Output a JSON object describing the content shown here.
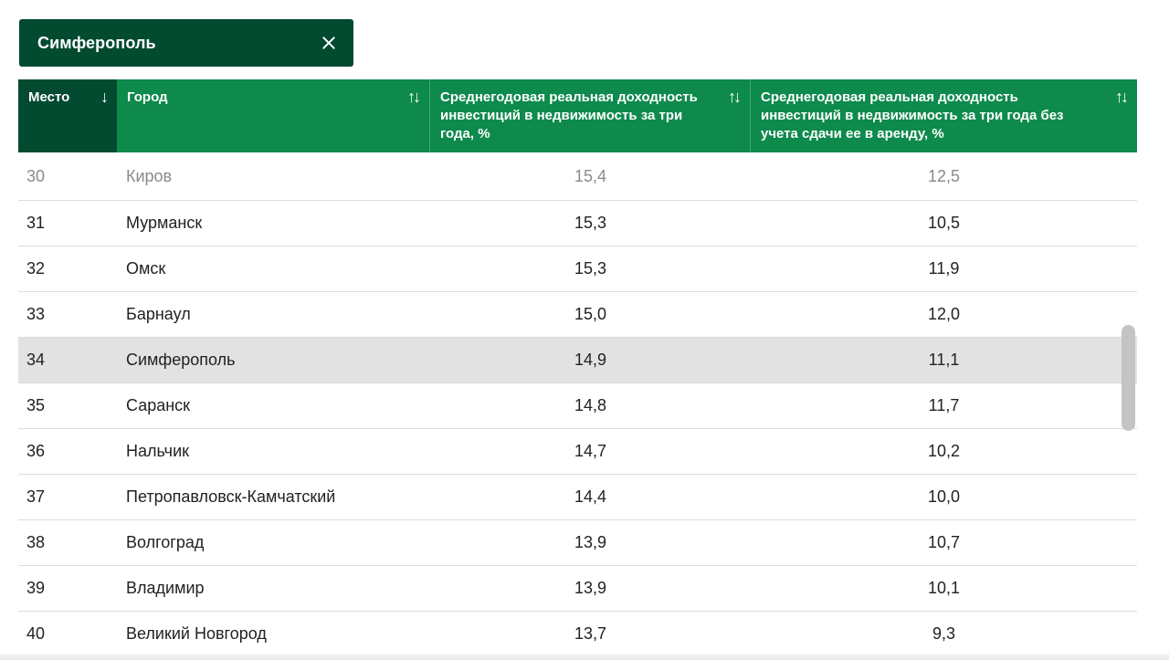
{
  "search_chip": {
    "label": "Симферополь",
    "close_icon": "close-icon"
  },
  "table": {
    "headers": [
      {
        "label": "Место",
        "sort_icon": "↓"
      },
      {
        "label": "Город",
        "sort_icon": "↑↓"
      },
      {
        "label": "Среднегодовая реальная доходность инвестиций в недвижимость за три года, %",
        "sort_icon": "↑↓"
      },
      {
        "label": "Среднегодовая реальная доходность инвестиций в недвижимость за три года без учета сдачи ее в аренду, %",
        "sort_icon": "↑↓"
      }
    ],
    "rows": [
      {
        "place": "30",
        "city": "Киров",
        "yield_rent": "15,4",
        "yield_no_rent": "12,5"
      },
      {
        "place": "31",
        "city": "Мурманск",
        "yield_rent": "15,3",
        "yield_no_rent": "10,5"
      },
      {
        "place": "32",
        "city": "Омск",
        "yield_rent": "15,3",
        "yield_no_rent": "11,9"
      },
      {
        "place": "33",
        "city": "Барнаул",
        "yield_rent": "15,0",
        "yield_no_rent": "12,0"
      },
      {
        "place": "34",
        "city": "Симферополь",
        "yield_rent": "14,9",
        "yield_no_rent": "11,1"
      },
      {
        "place": "35",
        "city": "Саранск",
        "yield_rent": "14,8",
        "yield_no_rent": "11,7"
      },
      {
        "place": "36",
        "city": "Нальчик",
        "yield_rent": "14,7",
        "yield_no_rent": "10,2"
      },
      {
        "place": "37",
        "city": "Петропавловск-Камчатский",
        "yield_rent": "14,4",
        "yield_no_rent": "10,0"
      },
      {
        "place": "38",
        "city": "Волгоград",
        "yield_rent": "13,9",
        "yield_no_rent": "10,7"
      },
      {
        "place": "39",
        "city": "Владимир",
        "yield_rent": "13,9",
        "yield_no_rent": "10,1"
      },
      {
        "place": "40",
        "city": "Великий Новгород",
        "yield_rent": "13,7",
        "yield_no_rent": "9,3"
      }
    ]
  },
  "colors": {
    "chip_bg": "#024a30",
    "header_bg": "#0e8a4c",
    "header_active_bg": "#024a30",
    "highlight_row": "#e2e2e2"
  }
}
